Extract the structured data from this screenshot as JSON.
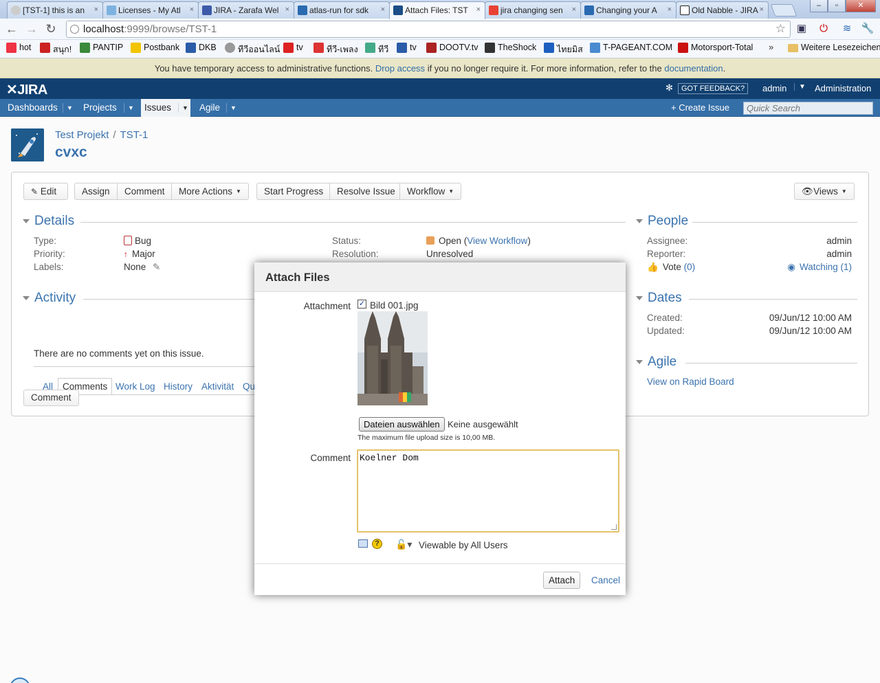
{
  "browser": {
    "tabs": [
      {
        "label": "[TST-1] this is an",
        "color": "#cccccc"
      },
      {
        "label": "Licenses - My Atl",
        "color": "#7db2e0"
      },
      {
        "label": "JIRA - Zarafa Wel",
        "color": "#3c5aa8"
      },
      {
        "label": "atlas-run for sdk",
        "color": "#2a6ab0"
      },
      {
        "label": "Attach Files: TST",
        "color": "#1b4d86"
      },
      {
        "label": "jira changing sen",
        "color": "#e94235"
      },
      {
        "label": "Changing your A",
        "color": "#2a6ab0"
      },
      {
        "label": "Old Nabble - JIRA",
        "color": "#222222"
      }
    ],
    "url_host": "localhost",
    "url_path": ":9999/browse/TST-1",
    "bookmarks": [
      {
        "label": "hot",
        "color": "#e34"
      },
      {
        "label": "สนุก!",
        "color": "#c22"
      },
      {
        "label": "PANTIP",
        "color": "#3a8a3a"
      },
      {
        "label": "Postbank",
        "color": "#f2c400"
      },
      {
        "label": "DKB",
        "color": "#2a5ca8"
      },
      {
        "label": "ทีวีออนไลน์",
        "color": "#999"
      },
      {
        "label": "tv",
        "color": "#d22"
      },
      {
        "label": "ทีวี-เพลง",
        "color": "#d33"
      },
      {
        "label": "ทีวี",
        "color": "#4a8"
      },
      {
        "label": "tv",
        "color": "#2a5ca8"
      },
      {
        "label": "DOOTV.tv",
        "color": "#a22"
      },
      {
        "label": "TheShock",
        "color": "#333"
      },
      {
        "label": "ไทยมิส",
        "color": "#1d5fbf"
      },
      {
        "label": "T-PAGEANT.COM",
        "color": "#4a8ad0"
      },
      {
        "label": "Motorsport-Total",
        "color": "#c11"
      }
    ],
    "bookmarks_more": "»",
    "other_bookmarks": "Weitere Lesezeichen"
  },
  "banner": {
    "text_before": "You have temporary access to administrative functions.",
    "drop_link": "Drop access",
    "text_middle": "if you no longer require it. For more information, refer to the",
    "doc_link": "documentation",
    "text_end": "."
  },
  "header": {
    "logo": "JIRA",
    "feedback": "GOT FEEDBACK?",
    "user": "admin",
    "administration": "Administration"
  },
  "nav": {
    "items": [
      "Dashboards",
      "Projects",
      "Issues",
      "Agile"
    ],
    "create_issue": "Create Issue",
    "search_placeholder": "Quick Search"
  },
  "issue": {
    "project": "Test Projekt",
    "key": "TST-1",
    "summary": "cvxc"
  },
  "toolbar": {
    "edit": "Edit",
    "assign": "Assign",
    "comment": "Comment",
    "more_actions": "More Actions",
    "start_progress": "Start Progress",
    "resolve_issue": "Resolve Issue",
    "workflow": "Workflow",
    "views": "Views"
  },
  "details": {
    "heading": "Details",
    "type_label": "Type:",
    "type_value": "Bug",
    "priority_label": "Priority:",
    "priority_value": "Major",
    "labels_label": "Labels:",
    "labels_value": "None",
    "status_label": "Status:",
    "status_value": "Open",
    "view_workflow": "View Workflow",
    "resolution_label": "Resolution:",
    "resolution_value": "Unresolved"
  },
  "activity": {
    "heading": "Activity",
    "tabs": [
      "All",
      "Comments",
      "Work Log",
      "History",
      "Aktivität",
      "Qu"
    ],
    "empty": "There are no comments yet on this issue.",
    "comment_button": "Comment"
  },
  "people": {
    "heading": "People",
    "assignee_label": "Assignee:",
    "assignee": "admin",
    "reporter_label": "Reporter:",
    "reporter": "admin",
    "vote": "Vote",
    "vote_count": "(0)",
    "watching": "Watching (1)"
  },
  "dates": {
    "heading": "Dates",
    "created_label": "Created:",
    "created": "09/Jun/12 10:00 AM",
    "updated_label": "Updated:",
    "updated": "09/Jun/12 10:00 AM"
  },
  "agile": {
    "heading": "Agile",
    "link": "View on Rapid Board"
  },
  "dialog": {
    "title": "Attach Files",
    "attachment_label": "Attachment",
    "filename": "Bild 001.jpg",
    "file_button": "Dateien auswählen",
    "file_none": "Keine ausgewählt",
    "file_note": "The maximum file upload size is 10,00 MB.",
    "comment_label": "Comment",
    "comment_value": "Koelner Dom",
    "viewable": "Viewable by All Users",
    "attach": "Attach",
    "cancel": "Cancel"
  }
}
